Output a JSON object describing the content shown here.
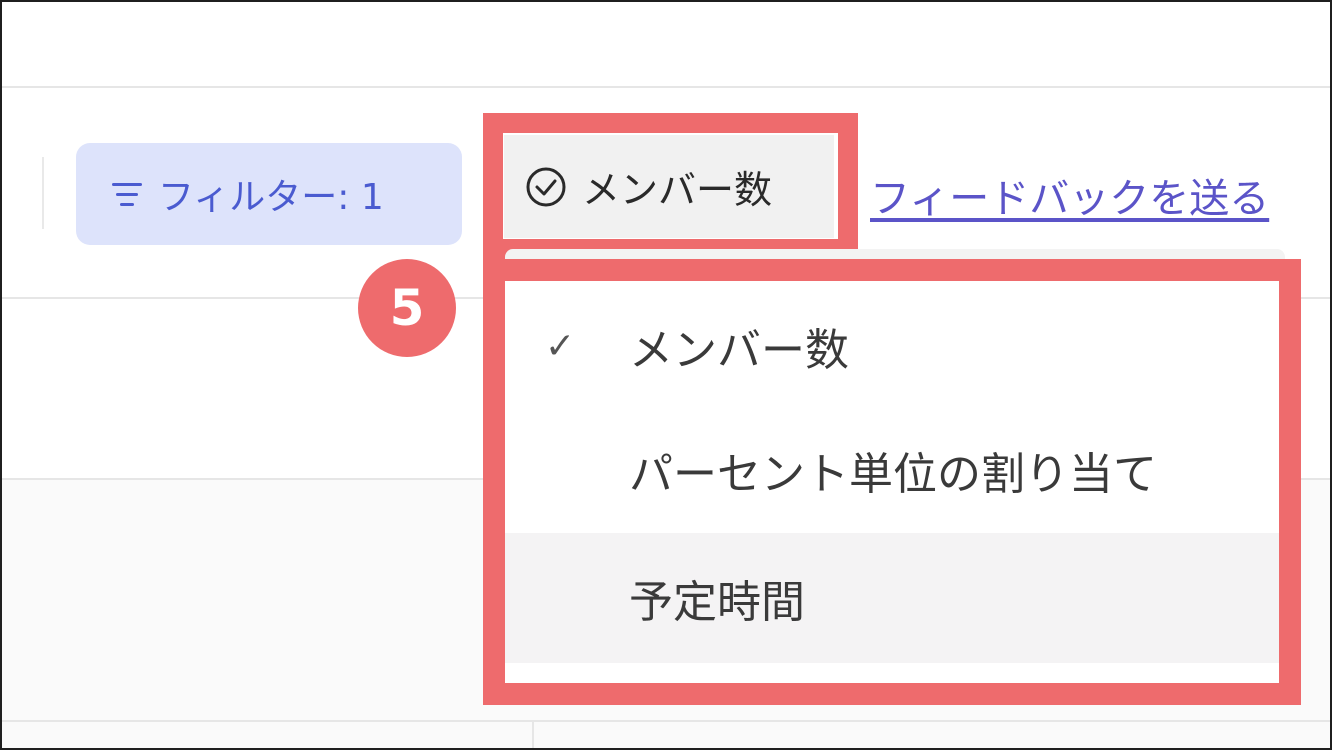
{
  "toolbar": {
    "filter_label": "フィルター: 1",
    "measure_label": "メンバー数",
    "feedback_link": "フィードバックを送る"
  },
  "dropdown": {
    "items": [
      {
        "label": "メンバー数",
        "selected": true
      },
      {
        "label": "パーセント単位の割り当て",
        "selected": false
      },
      {
        "label": "予定時間",
        "selected": false,
        "hovered": true
      }
    ],
    "check_glyph": "✓"
  },
  "annotation": {
    "step_number": "5",
    "highlight_color": "#ee6b6d"
  },
  "colors": {
    "filter_bg": "#dde3fb",
    "filter_text": "#4a5bd0",
    "link": "#5b54c8"
  },
  "icons": [
    "filter-icon",
    "check-circle-icon",
    "checkmark-icon"
  ]
}
